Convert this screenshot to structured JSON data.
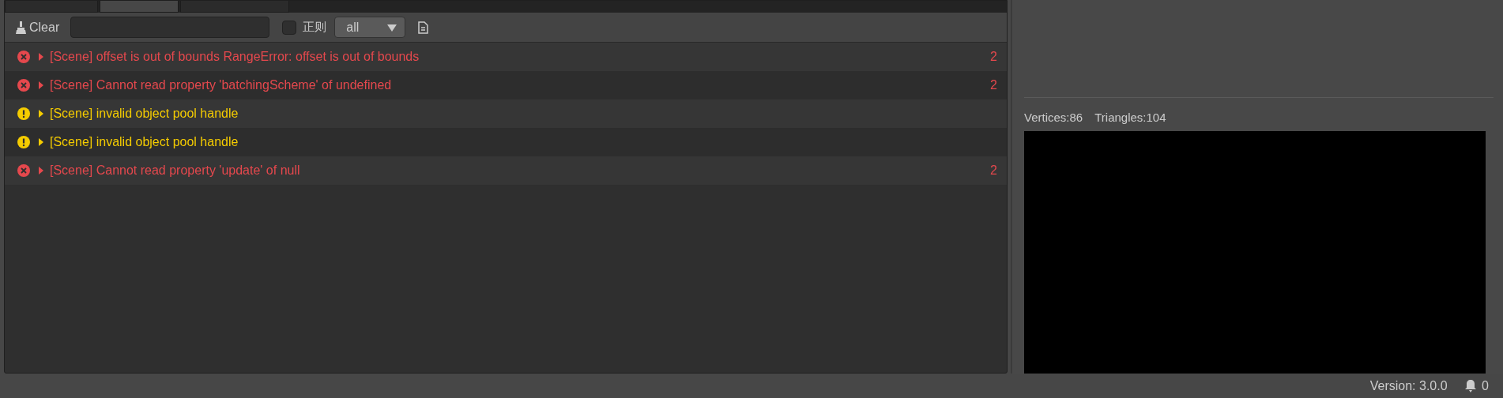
{
  "tabs": [
    {
      "selected": false
    },
    {
      "selected": true
    },
    {
      "selected": false
    }
  ],
  "toolbar": {
    "clear_label": "Clear",
    "regex": {
      "label": "正则",
      "checked": false
    },
    "level_select": {
      "value": "all"
    }
  },
  "logs": [
    {
      "kind": "error",
      "message": "[Scene] offset is out of bounds RangeError: offset is out of bounds",
      "count": "2",
      "expanded": false
    },
    {
      "kind": "error",
      "message": "[Scene] Cannot read property 'batchingScheme' of undefined",
      "count": "2",
      "expanded": false
    },
    {
      "kind": "warning",
      "message": "[Scene] invalid object pool handle",
      "expanded": false
    },
    {
      "kind": "warning",
      "message": "[Scene] invalid object pool handle",
      "expanded": false
    },
    {
      "kind": "error",
      "message": "[Scene] Cannot read property 'update' of null",
      "count": "2",
      "expanded": false
    }
  ],
  "preview": {
    "vertices": "Vertices:86",
    "triangles": "Triangles:104"
  },
  "status_bar": {
    "version": "Version: 3.0.0",
    "notifications": "0"
  }
}
